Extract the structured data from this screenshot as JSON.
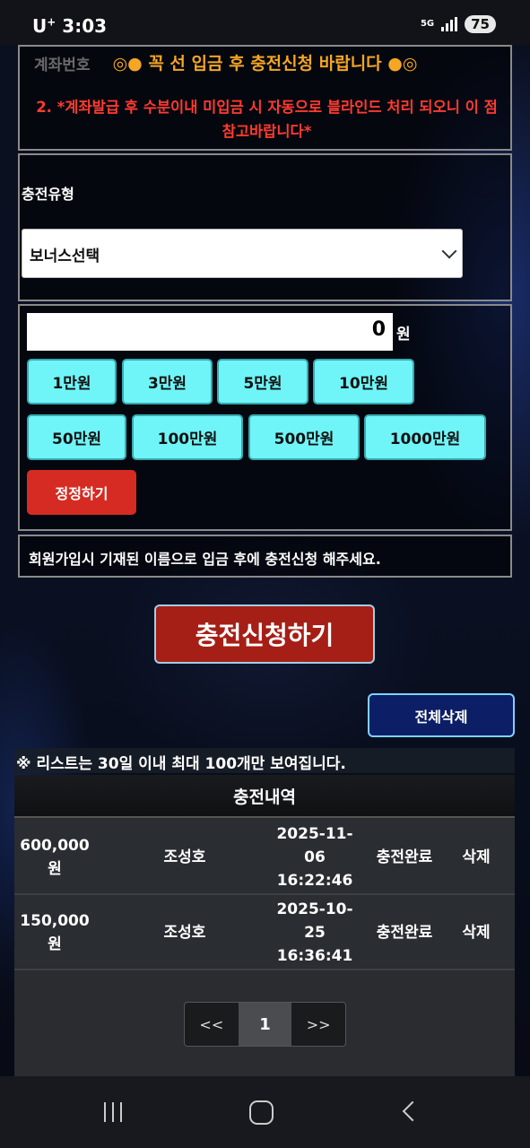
{
  "status_bar": {
    "carrier": "U",
    "carrier_sup": "+",
    "time": "3:03",
    "network": "5G",
    "battery": "75"
  },
  "notice": {
    "ghost_text": "계좌번호",
    "top_line": "◎● 꼭 선 입금 후 충전신청 바랍니다 ●◎",
    "warning": "2. *계좌발급 후 수분이내 미입금 시 자동으로 블라인드 처리 되오니 이 점 참고바랍니다*"
  },
  "charge_type": {
    "label": "충전유형",
    "select_value": "보너스선택"
  },
  "amount": {
    "value": "0",
    "unit": "원",
    "quick_buttons": [
      "1만원",
      "3만원",
      "5만원",
      "10만원",
      "50만원",
      "100만원",
      "500만원",
      "1000만원"
    ],
    "reset_label": "정정하기"
  },
  "info": "회원가입시 기재된 이름으로 입금 후에 충전신청 해주세요.",
  "submit_label": "충전신청하기",
  "delete_all_label": "전체삭제",
  "list_notice": "※ 리스트는 30일 이내 최대 100개만 보여집니다.",
  "history": {
    "title": "충전내역",
    "rows": [
      {
        "amount": "600,000 원",
        "name": "조성호",
        "date": "2025-11-06",
        "time": "16:22:46",
        "status": "충전완료",
        "action": "삭제"
      },
      {
        "amount": "150,000 원",
        "name": "조성호",
        "date": "2025-10-25",
        "time": "16:36:41",
        "status": "충전완료",
        "action": "삭제"
      }
    ]
  },
  "pagination": {
    "prev": "<<",
    "current": "1",
    "next": ">>"
  },
  "colors": {
    "quick_button": "#6ff5f8",
    "reset_button": "#d62b22",
    "submit_button": "#a51f16",
    "delete_all_button": "#0c1f66",
    "notice_orange": "#f5a623",
    "warning_red": "#ff3b30"
  }
}
